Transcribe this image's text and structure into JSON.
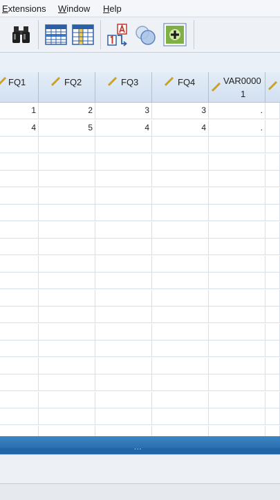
{
  "menu": {
    "items": [
      {
        "label": "Extensions",
        "mnemonic": "E",
        "rest": "xtensions"
      },
      {
        "label": "Window",
        "mnemonic": "W",
        "rest": "indow"
      },
      {
        "label": "Help",
        "mnemonic": "H",
        "rest": "elp"
      }
    ]
  },
  "toolbar": {
    "buttons": [
      {
        "icon": "binoculars-icon"
      },
      {
        "icon": "go-to-case-icon"
      },
      {
        "icon": "go-to-variable-icon"
      },
      {
        "icon": "value-labels-icon"
      },
      {
        "icon": "use-sets-icon"
      },
      {
        "icon": "add-extension-icon"
      }
    ]
  },
  "grid": {
    "columns": [
      {
        "label": "FQ1",
        "measure_icon": "scale-ruler-icon"
      },
      {
        "label": "FQ2",
        "measure_icon": "scale-ruler-icon"
      },
      {
        "label": "FQ3",
        "measure_icon": "scale-ruler-icon"
      },
      {
        "label": "FQ4",
        "measure_icon": "scale-ruler-icon"
      },
      {
        "label_line1": "VAR0000",
        "label_line2": "1",
        "measure_icon": "scale-ruler-icon"
      }
    ],
    "rows": [
      [
        "1",
        "2",
        "3",
        "3",
        "."
      ],
      [
        "4",
        "5",
        "4",
        "4",
        "."
      ]
    ]
  },
  "splitter": {
    "handle": "..."
  },
  "colors": {
    "divider": "#2f78b9",
    "header": "#dbe6f3",
    "gridline": "#d6e0ec"
  }
}
